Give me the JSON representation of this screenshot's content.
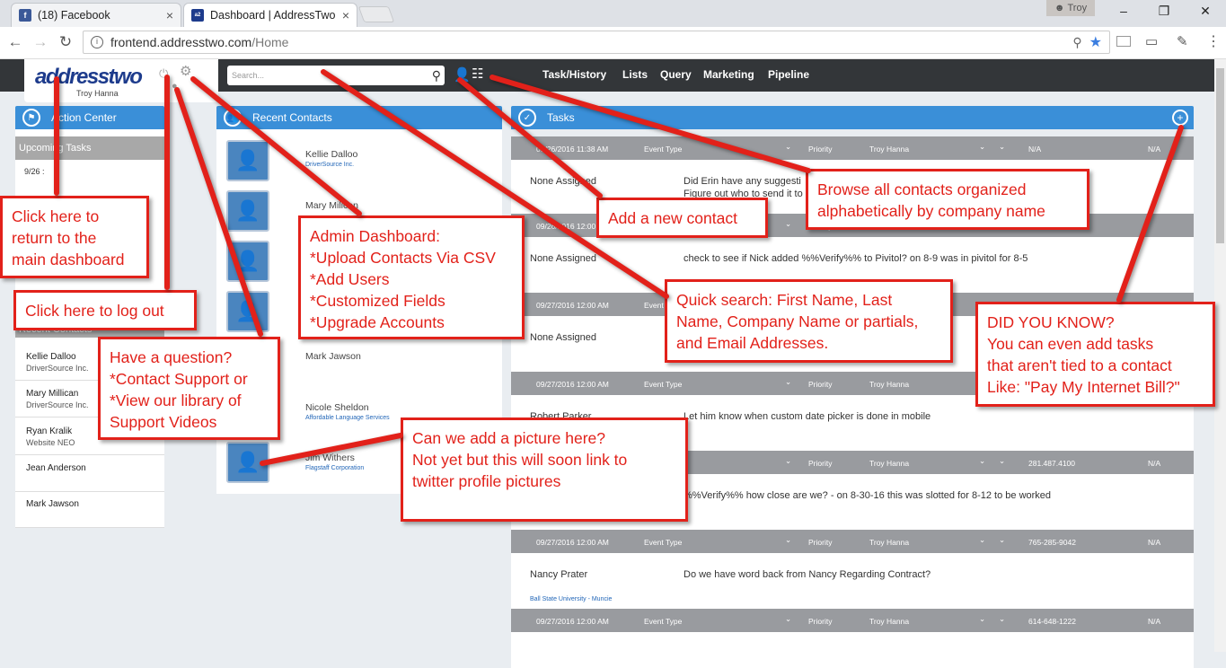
{
  "browser": {
    "tabs": [
      {
        "label": "(18) Facebook",
        "close": "×"
      },
      {
        "label": "Dashboard | AddressTwo",
        "close": "×"
      }
    ],
    "profile": "Troy",
    "url_host": "frontend.addresstwo.com",
    "url_path": "/Home",
    "window_controls": [
      "–",
      "❐",
      "✕"
    ]
  },
  "app": {
    "logo": "addresstwo",
    "user": "Troy Hanna",
    "search_placeholder": "Search...",
    "nav": [
      "Task/History",
      "Lists",
      "Query",
      "Marketing",
      "Pipeline"
    ]
  },
  "action_center": {
    "title": "Action Center",
    "upcoming": "Upcoming Tasks",
    "first_date": "9/26 :",
    "recent_label": "Recent Contacts",
    "contacts": [
      {
        "name": "Kellie Dalloo",
        "company": "DriverSource Inc."
      },
      {
        "name": "Mary Millican",
        "company": "DriverSource Inc."
      },
      {
        "name": "Ryan Kralik",
        "company": "Website NEO"
      },
      {
        "name": "Jean Anderson",
        "company": ""
      },
      {
        "name": "Mark Jawson",
        "company": ""
      }
    ]
  },
  "recent": {
    "title": "Recent Contacts",
    "contacts": [
      {
        "name": "Kellie Dalloo",
        "company": "DriverSource Inc."
      },
      {
        "name": "Mary Milican",
        "company": ""
      },
      {
        "name": "",
        "company": ""
      },
      {
        "name": "",
        "company": ""
      },
      {
        "name": "Mark Jawson",
        "company": ""
      },
      {
        "name": "Nicole Sheldon",
        "company": "Affordable Language Services"
      },
      {
        "name": "Jim Withers",
        "company": "Flagstaff Corporation"
      }
    ]
  },
  "tasks": {
    "title": "Tasks",
    "event_type": "Event Type",
    "priority": "Priority",
    "rows": [
      {
        "date": "09/26/2016 11:38 AM",
        "owner": "Troy Hanna",
        "phone": "N/A",
        "extra": "N/A",
        "assign": "None Assigned",
        "desc": "Did Erin have any suggesti",
        "desc2": "Figure out who to send it to",
        "sub": ""
      },
      {
        "date": "09/26/2016 12:00 AM",
        "owner": "",
        "phone": "N/A",
        "extra": "",
        "assign": "None Assigned",
        "desc": "check to see if Nick added %%Verify%% to Pivitol? on 8-9 was in pivitol for 8-5",
        "desc2": "",
        "sub": ""
      },
      {
        "date": "09/27/2016 12:00 AM",
        "owner": "",
        "phone": "",
        "extra": "",
        "assign": "None Assigned",
        "desc": "",
        "desc2": "",
        "sub": ""
      },
      {
        "date": "09/27/2016 12:00 AM",
        "owner": "Troy Hanna",
        "phone": "",
        "extra": "",
        "assign": "Robert Parker",
        "desc": "Let him know when custom date picker is done in mobile",
        "desc2": "",
        "sub": ""
      },
      {
        "date": "",
        "owner": "Troy Hanna",
        "phone": "281.487.4100",
        "extra": "N/A",
        "assign": "",
        "desc": "%%Verify%% how close are we? - on 8-30-16 this was slotted for 8-12 to be worked",
        "desc2": "",
        "sub": ""
      },
      {
        "date": "09/27/2016 12:00 AM",
        "owner": "Troy Hanna",
        "phone": "765-285-9042",
        "extra": "N/A",
        "assign": "Nancy Prater",
        "desc": "Do we have word back from Nancy Regarding Contract?",
        "desc2": "",
        "sub": "Ball State University - Muncie"
      },
      {
        "date": "09/27/2016 12:00 AM",
        "owner": "Troy Hanna",
        "phone": "614-648-1222",
        "extra": "N/A",
        "assign": "",
        "desc": "",
        "desc2": "",
        "sub": ""
      }
    ]
  },
  "callouts": {
    "dashboard": "Click here to\nreturn to the\nmain dashboard",
    "logout": "Click here to log out",
    "question": "Have a question?\n*Contact Support or\n*View our library of\nSupport Videos",
    "admin": "Admin Dashboard:\n*Upload Contacts Via CSV\n*Add Users\n*Customized Fields\n*Upgrade Accounts",
    "add_contact": "Add a new contact",
    "browse": "Browse all contacts organized\nalphabetically by company name",
    "quick_search": "Quick search: First Name, Last\nName, Company Name or partials,\nand Email Addresses.",
    "did_you_know": "DID YOU KNOW?\nYou can even add tasks\nthat aren't tied to a contact\nLike: \"Pay My Internet Bill?\"",
    "picture": "Can we add a picture here?\nNot yet but this will soon link to\ntwitter profile pictures"
  },
  "colors": {
    "accent": "#3a8fd8",
    "callout": "#e2211a",
    "header": "#333639"
  }
}
